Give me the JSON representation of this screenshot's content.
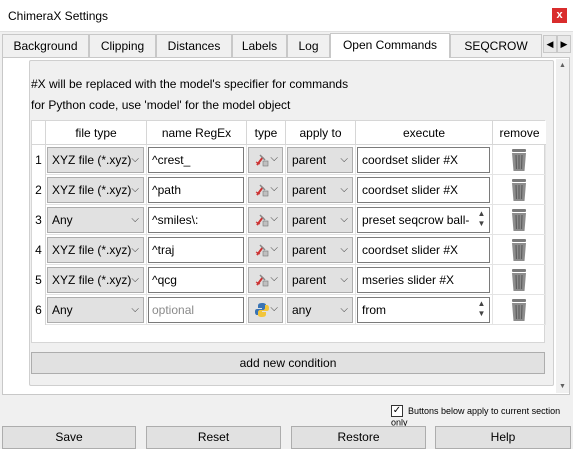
{
  "window": {
    "title": "ChimeraX Settings",
    "close_label": "x"
  },
  "tabs": [
    {
      "label": "Background"
    },
    {
      "label": "Clipping"
    },
    {
      "label": "Distances"
    },
    {
      "label": "Labels"
    },
    {
      "label": "Log"
    },
    {
      "label": "Open Commands"
    },
    {
      "label": "SEQCROW"
    }
  ],
  "tab_nav": {
    "prev": "◀",
    "next": "▶"
  },
  "info": {
    "line1": "#X will be replaced with the model's specifier for commands",
    "line2": "for Python code, use 'model' for the model object"
  },
  "table": {
    "headers": [
      "file type",
      "name RegEx",
      "type",
      "apply to",
      "execute",
      "remove"
    ],
    "rows": [
      {
        "num": "1",
        "file_type": "XYZ file (*.xyz)",
        "regex": "^crest_",
        "regex_placeholder": "",
        "type_icon": "command-icon",
        "apply_to": "parent",
        "execute": "coordset slider #X",
        "multiline": false
      },
      {
        "num": "2",
        "file_type": "XYZ file (*.xyz)",
        "regex": "^path",
        "regex_placeholder": "",
        "type_icon": "command-icon",
        "apply_to": "parent",
        "execute": "coordset slider #X",
        "multiline": false
      },
      {
        "num": "3",
        "file_type": "Any",
        "regex": "^smiles\\:",
        "regex_placeholder": "",
        "type_icon": "command-icon",
        "apply_to": "parent",
        "execute": "preset seqcrow ball-",
        "multiline": true
      },
      {
        "num": "4",
        "file_type": "XYZ file (*.xyz)",
        "regex": "^traj",
        "regex_placeholder": "",
        "type_icon": "command-icon",
        "apply_to": "parent",
        "execute": "coordset slider #X",
        "multiline": false
      },
      {
        "num": "5",
        "file_type": "XYZ file (*.xyz)",
        "regex": "^qcg",
        "regex_placeholder": "",
        "type_icon": "command-icon",
        "apply_to": "parent",
        "execute": "mseries slider #X",
        "multiline": false
      },
      {
        "num": "6",
        "file_type": "Any",
        "regex": "",
        "regex_placeholder": "optional",
        "type_icon": "python-icon",
        "apply_to": "any",
        "execute": "from",
        "multiline": true
      }
    ]
  },
  "add_condition_label": "add new condition",
  "bottom_checkbox": {
    "label": "Buttons below apply to current section only",
    "checked": true
  },
  "buttons": {
    "save": "Save",
    "reset": "Reset",
    "restore": "Restore",
    "help": "Help"
  }
}
